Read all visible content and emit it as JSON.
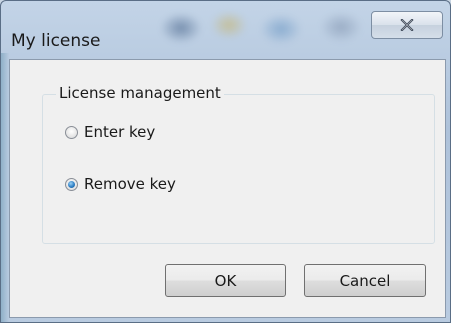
{
  "window": {
    "title": "My license"
  },
  "title_bar": {
    "close_icon": "close-x-icon"
  },
  "group": {
    "legend": "License management",
    "options": [
      {
        "label": "Enter key",
        "checked": false
      },
      {
        "label": "Remove key",
        "checked": true
      }
    ]
  },
  "buttons": {
    "ok_label": "OK",
    "cancel_label": "Cancel"
  },
  "colors": {
    "title_glass": "#aec2da",
    "client_bg": "#f0f0f0",
    "radio_selected": "#2e7fc4"
  }
}
